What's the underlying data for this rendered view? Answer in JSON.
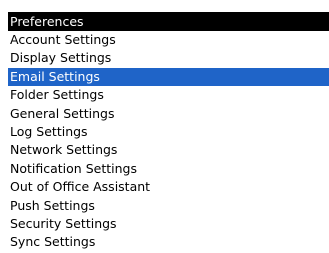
{
  "screen": {
    "title": "Preferences",
    "selected_index": 2,
    "colors": {
      "title_bar_bg": "#000000",
      "title_bar_text": "#ffffff",
      "selected_bg": "#1f64c8",
      "selected_text": "#ffffff",
      "background": "#ffffff"
    }
  },
  "menu": {
    "items": [
      {
        "label": "Account Settings"
      },
      {
        "label": "Display Settings"
      },
      {
        "label": "Email Settings"
      },
      {
        "label": "Folder Settings"
      },
      {
        "label": "General Settings"
      },
      {
        "label": "Log Settings"
      },
      {
        "label": "Network Settings"
      },
      {
        "label": "Notification Settings"
      },
      {
        "label": "Out of Office Assistant"
      },
      {
        "label": "Push Settings"
      },
      {
        "label": "Security Settings"
      },
      {
        "label": "Sync Settings"
      }
    ]
  }
}
